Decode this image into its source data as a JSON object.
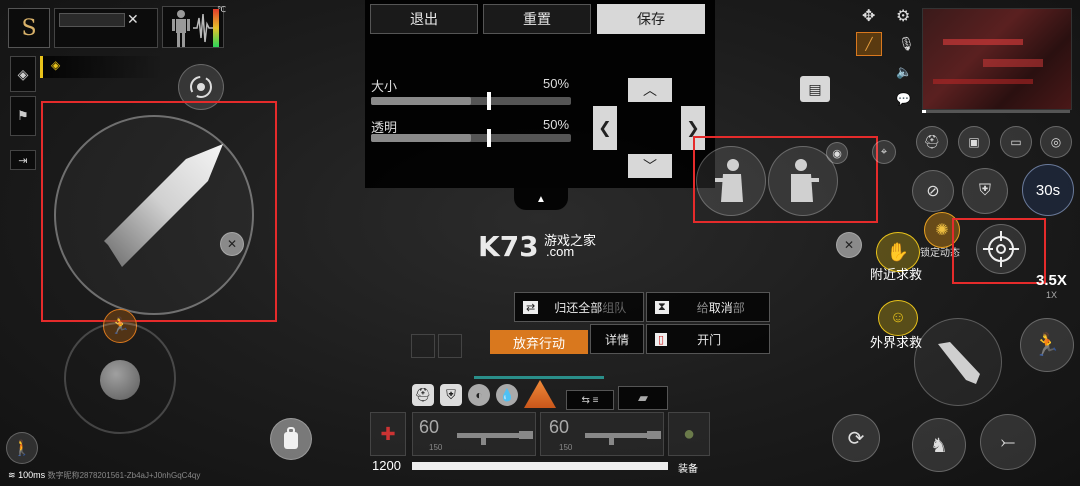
{
  "top_menu": {
    "exit_label": "退出",
    "reset_label": "重置",
    "save_label": "保存"
  },
  "settings_panel": {
    "size_label": "大小",
    "size_value": "50%",
    "size_fraction": 0.5,
    "opacity_label": "透明",
    "opacity_value": "50%",
    "opacity_fraction": 0.5
  },
  "watermark": {
    "logo_text": "K73",
    "site_text": "游戏之家",
    "domain_text": ".com"
  },
  "team_actions": {
    "return_all_label": "归还全部",
    "team_label": "组队",
    "give_label": "给",
    "cancel_label": "取消",
    "dept_label": "部",
    "abandon_label": "放弃行动",
    "details_label": "详情",
    "open_door_label": "开门"
  },
  "right_panel": {
    "nearby_rescue_label": "附近求救",
    "outside_rescue_label": "外界求救",
    "lock_dynamic_label": "锁定动态",
    "timer_label": "30s",
    "zoom_label": "3.5X",
    "zoom_sub_label": "1X"
  },
  "weapons": {
    "slot1_ammo": "60",
    "slot1_reserve": "150",
    "slot2_ammo": "60",
    "slot2_reserve": "150",
    "equip_label": "装备",
    "money": "1200"
  },
  "status": {
    "ping": "100ms",
    "player_id": "数字昵称2878201561-Zb4aJ+J0nhGqC4qy",
    "temp_unit": "℃"
  },
  "colors": {
    "highlight_red": "#e52b2b",
    "accent_orange": "#d9781e",
    "rescue_yellow": "#e8c21a"
  }
}
